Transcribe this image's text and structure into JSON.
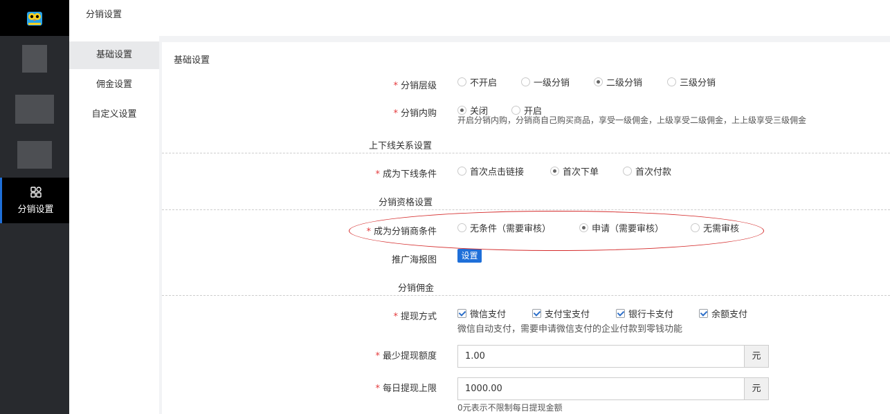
{
  "header": {
    "title": "分销设置"
  },
  "rail": {
    "active_label": "分销设置",
    "active_icon": "grid-icon",
    "accent": "#1e6fd9"
  },
  "sub_nav": {
    "items": [
      "基础设置",
      "佣金设置",
      "自定义设置"
    ],
    "active_index": 0
  },
  "section": {
    "title": "基础设置"
  },
  "levels": {
    "label": "分销层级",
    "options": [
      "不开启",
      "一级分销",
      "二级分销",
      "三级分销"
    ],
    "selected": "二级分销"
  },
  "internal": {
    "label": "分销内购",
    "options": [
      "关闭",
      "开启"
    ],
    "selected": "关闭",
    "help": "开启分销内购，分销商自己购买商品，享受一级佣金，上级享受二级佣金，上上级享受三级佣金"
  },
  "groups": {
    "relation": "上下线关系设置",
    "qualification": "分销资格设置",
    "commission": "分销佣金"
  },
  "downline": {
    "label": "成为下线条件",
    "options": [
      "首次点击链接",
      "首次下单",
      "首次付款"
    ],
    "selected": "首次下单"
  },
  "distributor": {
    "label": "成为分销商条件",
    "options": [
      "无条件（需要审核）",
      "申请（需要审核）",
      "无需审核"
    ],
    "selected": "申请（需要审核）"
  },
  "poster": {
    "label": "推广海报图",
    "button": "设置"
  },
  "withdraw": {
    "label": "提现方式",
    "options": [
      "微信支付",
      "支付宝支付",
      "银行卡支付",
      "余额支付"
    ],
    "checked": [
      "微信支付",
      "支付宝支付",
      "银行卡支付",
      "余额支付"
    ],
    "help": "微信自动支付，需要申请微信支付的企业付款到零钱功能"
  },
  "min_withdraw": {
    "label": "最少提现额度",
    "value": "1.00",
    "unit": "元"
  },
  "daily_limit": {
    "label": "每日提现上限",
    "value": "1000.00",
    "unit": "元",
    "help": "0元表示不限制每日提现金额"
  },
  "colors": {
    "primary": "#1e6fd9",
    "required": "#e4393c",
    "annotation": "#d42a2a"
  }
}
